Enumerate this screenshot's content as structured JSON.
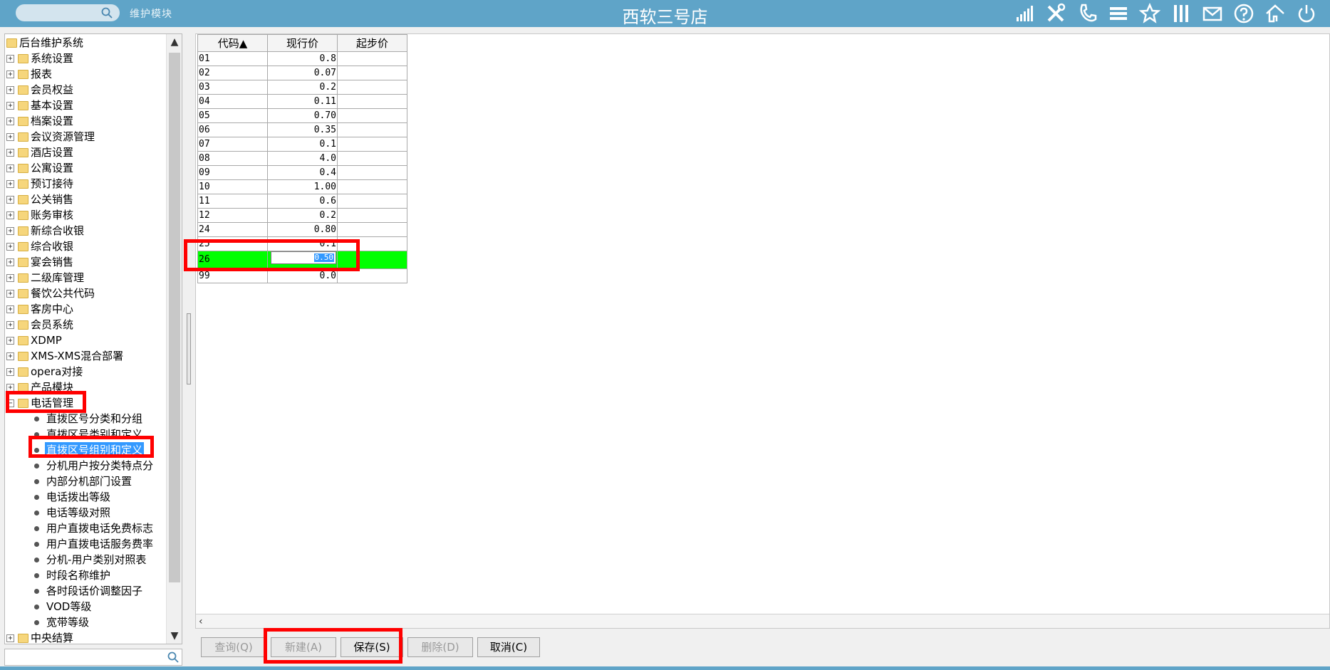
{
  "header": {
    "title": "西软三号店",
    "module_label": "维护模块",
    "search_placeholder": ""
  },
  "colors": {
    "header_bg": "#5fa4c8",
    "selected_row": "#00ff00",
    "selection_blue": "#3399ff",
    "highlight_red": "#ff0000"
  },
  "top_icons": [
    "signal-icon",
    "tools-icon",
    "phone-icon",
    "menu-icon",
    "star-icon",
    "columns-icon",
    "mail-icon",
    "help-icon",
    "house-icon",
    "power-icon"
  ],
  "tree": {
    "root": "后台维护系统",
    "items": [
      {
        "label": "系统设置"
      },
      {
        "label": "报表"
      },
      {
        "label": "会员权益"
      },
      {
        "label": "基本设置"
      },
      {
        "label": "档案设置"
      },
      {
        "label": "会议资源管理"
      },
      {
        "label": "酒店设置"
      },
      {
        "label": "公寓设置"
      },
      {
        "label": "预订接待"
      },
      {
        "label": "公关销售"
      },
      {
        "label": "账务审核"
      },
      {
        "label": "新综合收银"
      },
      {
        "label": "综合收银"
      },
      {
        "label": "宴会销售"
      },
      {
        "label": "二级库管理"
      },
      {
        "label": "餐饮公共代码"
      },
      {
        "label": "客房中心"
      },
      {
        "label": "会员系统"
      },
      {
        "label": "XDMP"
      },
      {
        "label": "XMS-XMS混合部署"
      },
      {
        "label": "opera对接"
      },
      {
        "label": "产品模块"
      },
      {
        "label": "电话管理"
      }
    ],
    "children": [
      {
        "label": "直拨区号分类和分组"
      },
      {
        "label": "直拨区号类别和定义"
      },
      {
        "label": "直拨区号组别和定义"
      },
      {
        "label": "分机用户按分类特点分"
      },
      {
        "label": "内部分机部门设置"
      },
      {
        "label": "电话拨出等级"
      },
      {
        "label": "电话等级对照"
      },
      {
        "label": "用户直拨电话免费标志"
      },
      {
        "label": "用户直拨电话服务费率"
      },
      {
        "label": "分机-用户类别对照表"
      },
      {
        "label": "时段名称维护"
      },
      {
        "label": "各时段话价调整因子"
      },
      {
        "label": "VOD等级"
      },
      {
        "label": "宽带等级"
      }
    ],
    "last_item": "中央结算"
  },
  "grid": {
    "columns": [
      "代码▲",
      "现行价",
      "起步价"
    ],
    "rows": [
      {
        "code": "01",
        "price": "0.8",
        "start": ""
      },
      {
        "code": "02",
        "price": "0.07",
        "start": ""
      },
      {
        "code": "03",
        "price": "0.2",
        "start": ""
      },
      {
        "code": "04",
        "price": "0.11",
        "start": ""
      },
      {
        "code": "05",
        "price": "0.70",
        "start": ""
      },
      {
        "code": "06",
        "price": "0.35",
        "start": ""
      },
      {
        "code": "07",
        "price": "0.1",
        "start": ""
      },
      {
        "code": "08",
        "price": "4.0",
        "start": ""
      },
      {
        "code": "09",
        "price": "0.4",
        "start": ""
      },
      {
        "code": "10",
        "price": "1.00",
        "start": ""
      },
      {
        "code": "11",
        "price": "0.6",
        "start": ""
      },
      {
        "code": "12",
        "price": "0.2",
        "start": ""
      },
      {
        "code": "24",
        "price": "0.80",
        "start": ""
      },
      {
        "code": "25",
        "price": "0.1",
        "start": ""
      },
      {
        "code": "26",
        "price": "0.50",
        "start": ""
      },
      {
        "code": "99",
        "price": "0.0",
        "start": ""
      }
    ]
  },
  "buttons": {
    "query": "查询(Q)",
    "new": "新建(A)",
    "save": "保存(S)",
    "delete": "删除(D)",
    "cancel": "取消(C)"
  }
}
